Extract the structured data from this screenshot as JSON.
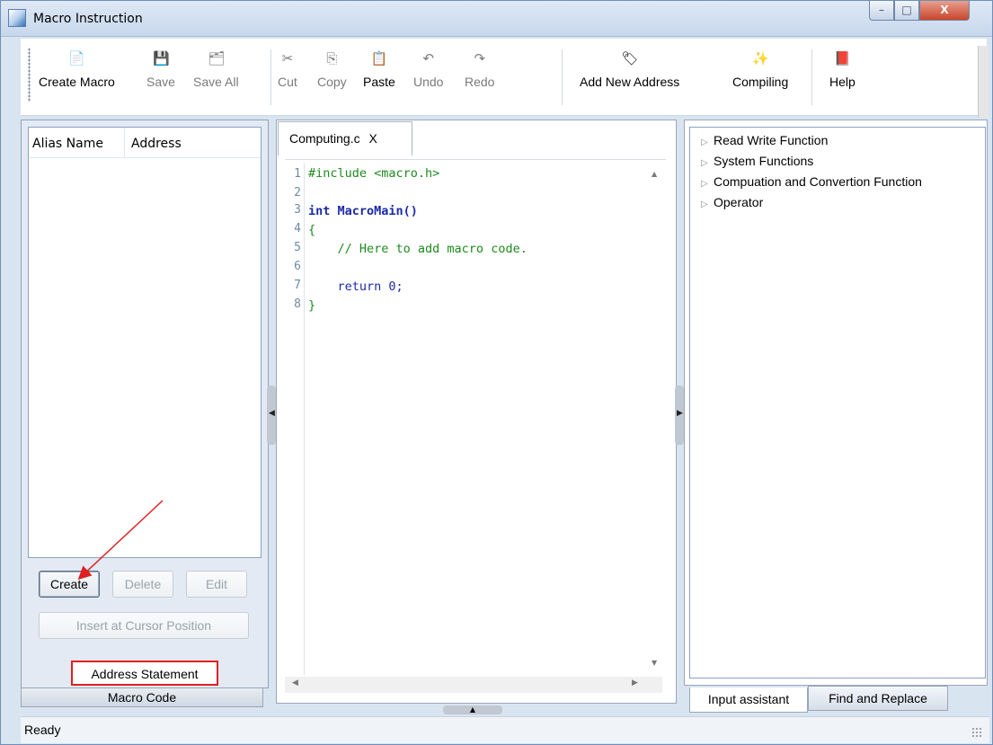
{
  "window": {
    "title": "Macro Instruction",
    "min": "–",
    "max": "□",
    "close": "X"
  },
  "toolbar": {
    "create_macro": "Create Macro",
    "save": "Save",
    "save_all": "Save All",
    "cut": "Cut",
    "copy": "Copy",
    "paste": "Paste",
    "undo": "Undo",
    "redo": "Redo",
    "add_new_address": "Add New Address",
    "compiling": "Compiling",
    "help": "Help"
  },
  "left": {
    "columns": [
      "Alias Name",
      "Address"
    ],
    "buttons": {
      "create": "Create",
      "delete": "Delete",
      "edit": "Edit",
      "insert": "Insert at Cursor Position"
    },
    "tabs": {
      "address_statement": "Address Statement",
      "macro_code": "Macro Code"
    }
  },
  "editor": {
    "tab_label": "Computing.c",
    "tab_close": "X",
    "line_numbers": [
      "1",
      "2",
      "3",
      "4",
      "5",
      "6",
      "7",
      "8"
    ],
    "lines": [
      "#include <macro.h>",
      "",
      "int MacroMain()",
      "{",
      "    // Here to add macro code.",
      "",
      "    return 0;",
      "}"
    ]
  },
  "right": {
    "tree": [
      "Read Write Function",
      "System Functions",
      "Compuation and Convertion Function",
      "Operator"
    ],
    "tabs": {
      "input_assistant": "Input assistant",
      "find_replace": "Find and Replace"
    }
  },
  "status": {
    "text": "Ready"
  },
  "colors": {
    "annotation": "#e02020",
    "code_green": "#1d8a1d",
    "code_blue": "#1b2aa7"
  }
}
